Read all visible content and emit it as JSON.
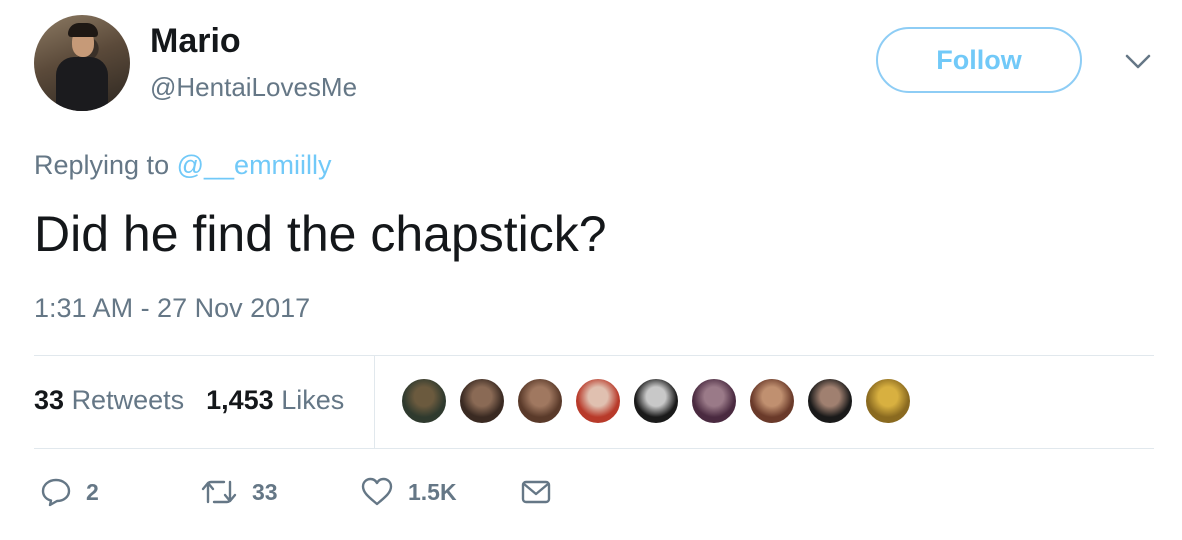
{
  "user": {
    "name": "Mario",
    "handle": "@HentaiLovesMe",
    "follow_label": "Follow"
  },
  "reply": {
    "prefix": "Replying to",
    "mention": "@__emmiilly"
  },
  "tweet": {
    "text": "Did he find the chapstick?",
    "timestamp": "1:31 AM - 27 Nov 2017"
  },
  "stats": {
    "retweets_count": "33",
    "retweets_label": "Retweets",
    "likes_count": "1,453",
    "likes_label": "Likes"
  },
  "liker_avatars": [
    {
      "colors": [
        "#2f3a2e",
        "#6b5a3e"
      ]
    },
    {
      "colors": [
        "#3a2a22",
        "#8a6a55"
      ]
    },
    {
      "colors": [
        "#5a3a2a",
        "#a07860"
      ]
    },
    {
      "colors": [
        "#b83a2a",
        "#e0c0b0"
      ]
    },
    {
      "colors": [
        "#1a1a1a",
        "#c8c8c8"
      ]
    },
    {
      "colors": [
        "#4a2a40",
        "#9a7a88"
      ]
    },
    {
      "colors": [
        "#6a3a2a",
        "#c09070"
      ]
    },
    {
      "colors": [
        "#1a1a1a",
        "#a08070"
      ]
    },
    {
      "colors": [
        "#8a6a20",
        "#d8b040"
      ]
    }
  ],
  "actions": {
    "reply_count": "2",
    "retweet_count": "33",
    "like_count": "1.5K"
  },
  "colors": {
    "accent": "#71c9f8",
    "muted": "#657786",
    "text": "#14171a",
    "divider": "#e1e8ed"
  }
}
